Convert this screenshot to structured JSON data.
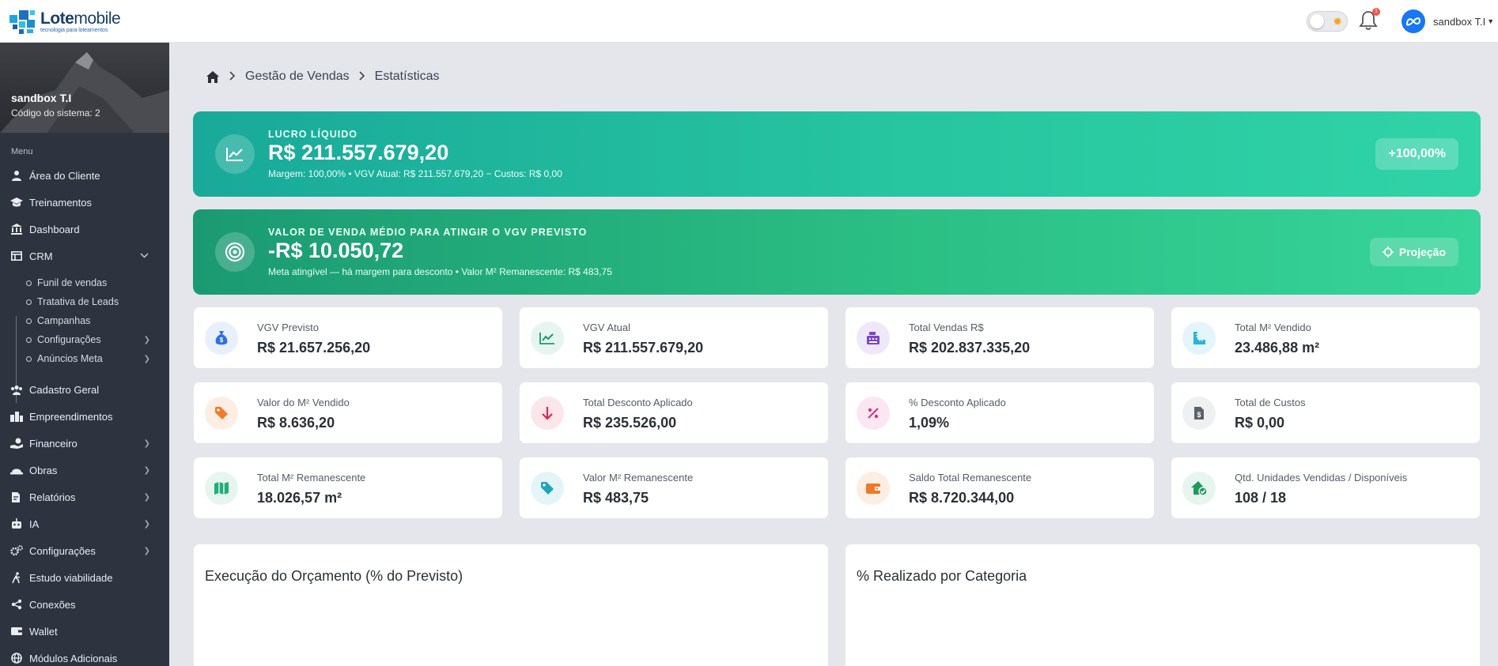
{
  "header": {
    "logo_bold": "Lote",
    "logo_light": "mobile",
    "logo_tagline": "tecnologia para loteamentos",
    "notification_count": "1",
    "user_name": "sandbox T.I"
  },
  "sidebar": {
    "user_name": "sandbox T.I",
    "system_code": "Código do sistema: 2",
    "menu_label": "Menu",
    "items": [
      {
        "label": "Área do Cliente",
        "icon": "user-icon"
      },
      {
        "label": "Treinamentos",
        "icon": "graduation-cap-icon"
      },
      {
        "label": "Dashboard",
        "icon": "bank-icon"
      },
      {
        "label": "CRM",
        "icon": "table-icon"
      },
      {
        "label": "Cadastro Geral",
        "icon": "users-icon"
      },
      {
        "label": "Empreendimentos",
        "icon": "city-icon"
      },
      {
        "label": "Financeiro",
        "icon": "money-hand-icon"
      },
      {
        "label": "Obras",
        "icon": "helmet-icon"
      },
      {
        "label": "Relatórios",
        "icon": "file-edit-icon"
      },
      {
        "label": "IA",
        "icon": "robot-icon"
      },
      {
        "label": "Configurações",
        "icon": "gears-icon"
      },
      {
        "label": "Estudo viabilidade",
        "icon": "person-walk-icon"
      },
      {
        "label": "Conexões",
        "icon": "share-icon"
      },
      {
        "label": "Wallet",
        "icon": "wallet-icon"
      },
      {
        "label": "Módulos Adicionais",
        "icon": "globe-icon"
      }
    ],
    "crm_sub": [
      {
        "label": "Funil de vendas"
      },
      {
        "label": "Tratativa de Leads"
      },
      {
        "label": "Campanhas"
      },
      {
        "label": "Configurações"
      },
      {
        "label": "Anúncios Meta"
      }
    ]
  },
  "breadcrumb": {
    "level1": "Gestão de Vendas",
    "level2": "Estatísticas"
  },
  "banners": {
    "lucro": {
      "label": "LUCRO LÍQUIDO",
      "value": "R$ 211.557.679,20",
      "detail": "Margem: 100,00% • VGV Atual: R$ 211.557.679,20 − Custos: R$ 0,00",
      "pill": "+100,00%"
    },
    "vgv_medio": {
      "label": "VALOR DE VENDA MÉDIO PARA ATINGIR O VGV PREVISTO",
      "value": "-R$ 10.050,72",
      "detail": "Meta atingível — há margem para desconto • Valor M² Remanescente: R$ 483,75",
      "button": "Projeção"
    }
  },
  "cards": [
    {
      "label": "VGV Previsto",
      "value": "R$ 21.657.256,20",
      "icon": "money-bag-icon",
      "color": "#2f6fe4",
      "bg": "#e8effd"
    },
    {
      "label": "VGV Atual",
      "value": "R$ 211.557.679,20",
      "icon": "line-chart-icon",
      "color": "#1a9a6b",
      "bg": "#e6f5ef"
    },
    {
      "label": "Total Vendas R$",
      "value": "R$ 202.837.335,20",
      "icon": "cash-register-icon",
      "color": "#7a45d1",
      "bg": "#efe8fb"
    },
    {
      "label": "Total M² Vendido",
      "value": "23.486,88 m²",
      "icon": "ruler-icon",
      "color": "#28b6d8",
      "bg": "#e4f6fb"
    },
    {
      "label": "Valor do M² Vendido",
      "value": "R$ 8.636,20",
      "icon": "tag-icon",
      "color": "#f27b2a",
      "bg": "#fdeee3"
    },
    {
      "label": "Total Desconto Aplicado",
      "value": "R$ 235.526,00",
      "icon": "arrow-down-icon",
      "color": "#d62a4e",
      "bg": "#fbe6ea"
    },
    {
      "label": "% Desconto Aplicado",
      "value": "1,09%",
      "icon": "percent-icon",
      "color": "#d63384",
      "bg": "#fbe7f1"
    },
    {
      "label": "Total de Custos",
      "value": "R$ 0,00",
      "icon": "invoice-icon",
      "color": "#5a6169",
      "bg": "#eef0f2"
    },
    {
      "label": "Total M² Remanescente",
      "value": "18.026,57 m²",
      "icon": "map-icon",
      "color": "#1fae78",
      "bg": "#e6f6ef"
    },
    {
      "label": "Valor M² Remanescente",
      "value": "R$ 483,75",
      "icon": "tag-icon",
      "color": "#1fa8b8",
      "bg": "#e4f5f7"
    },
    {
      "label": "Saldo Total Remanescente",
      "value": "R$ 8.720.344,00",
      "icon": "wallet-icon",
      "color": "#f0782a",
      "bg": "#fdeee3"
    },
    {
      "label": "Qtd. Unidades Vendidas / Disponíveis",
      "value": "108 / 18",
      "icon": "house-check-icon",
      "color": "#1e9b5a",
      "bg": "#e6f5ed"
    }
  ],
  "panels": {
    "left_title": "Execução do Orçamento (% do Previsto)",
    "right_title": "% Realizado por Categoria"
  },
  "colors": {
    "sidebar_bg": "#2d3440",
    "accent_teal": "#27c5a0",
    "accent_green": "#2bbf84",
    "page_bg": "#e4e6eb"
  }
}
